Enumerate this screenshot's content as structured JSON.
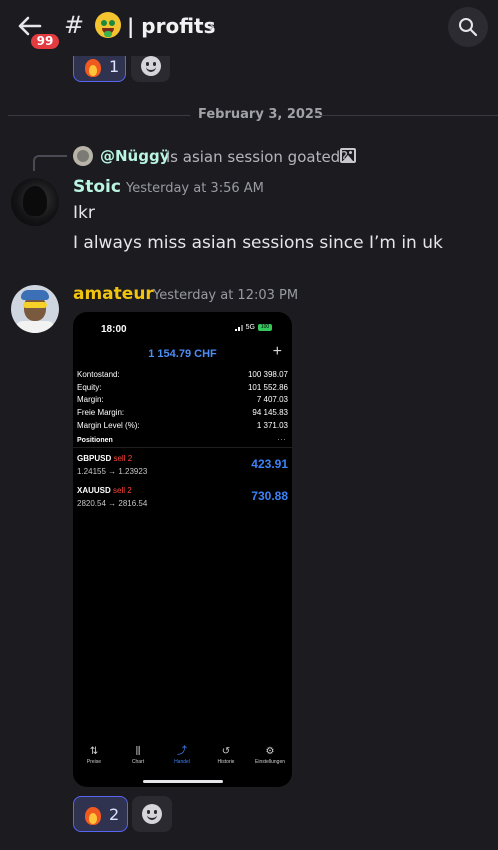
{
  "header": {
    "unread_badge": "99",
    "hash_symbol": "#",
    "channel_name": "| profits",
    "chevron": "›",
    "back_icon": "arrow-left-icon",
    "search_icon": "search-icon"
  },
  "top_reactions": [
    {
      "emoji": "fire",
      "count": "1"
    },
    {
      "emoji": "add-reaction",
      "count": ""
    }
  ],
  "date_divider": "February 3, 2025",
  "messages": [
    {
      "reply": {
        "name": "@Nüggÿ",
        "text": "is asian session goated?",
        "has_image_icon": true
      },
      "author": "Stoic",
      "author_color": "#b9f5e0",
      "time": "Yesterday at 3:56 AM",
      "lines": [
        "Ikr",
        "I always miss asian sessions since I’m in uk"
      ]
    },
    {
      "author": "amateur",
      "author_color": "#f1c40f",
      "time": "Yesterday at 12:03 PM",
      "attachment": {
        "status_time": "18:00",
        "network": "5G",
        "battery": "100",
        "balance": "1 154.79 CHF",
        "plus_icon": "+",
        "account": [
          {
            "label": "Kontostand:",
            "value": "100 398.07"
          },
          {
            "label": "Equity:",
            "value": "101 552.86"
          },
          {
            "label": "Margin:",
            "value": "7 407.03"
          },
          {
            "label": "Freie Margin:",
            "value": "94 145.83"
          },
          {
            "label": "Margin Level (%):",
            "value": "1 371.03"
          }
        ],
        "positions_title": "Positionen",
        "positions_menu": "···",
        "positions": [
          {
            "symbol": "GBPUSD",
            "side": "sell 2",
            "prices": "1.24155 → 1.23923",
            "profit": "423.91"
          },
          {
            "symbol": "XAUUSD",
            "side": "sell 2",
            "prices": "2820.54 → 2816.54",
            "profit": "730.88"
          }
        ],
        "tabs": [
          {
            "icon": "⇅",
            "label": "Preise"
          },
          {
            "icon": "⫼",
            "label": "Chart"
          },
          {
            "icon": "⤴",
            "label": "Handel"
          },
          {
            "icon": "↺",
            "label": "Historie"
          },
          {
            "icon": "⚙",
            "label": "Einstellungen"
          }
        ],
        "active_tab": "Handel"
      },
      "reactions": [
        {
          "emoji": "fire",
          "count": "2"
        },
        {
          "emoji": "add-reaction",
          "count": ""
        }
      ]
    }
  ],
  "colors": {
    "accent": "#5865f2",
    "profit_blue": "#3b82f6",
    "sell_red": "#ff453a",
    "badge_red": "#e23b40"
  }
}
